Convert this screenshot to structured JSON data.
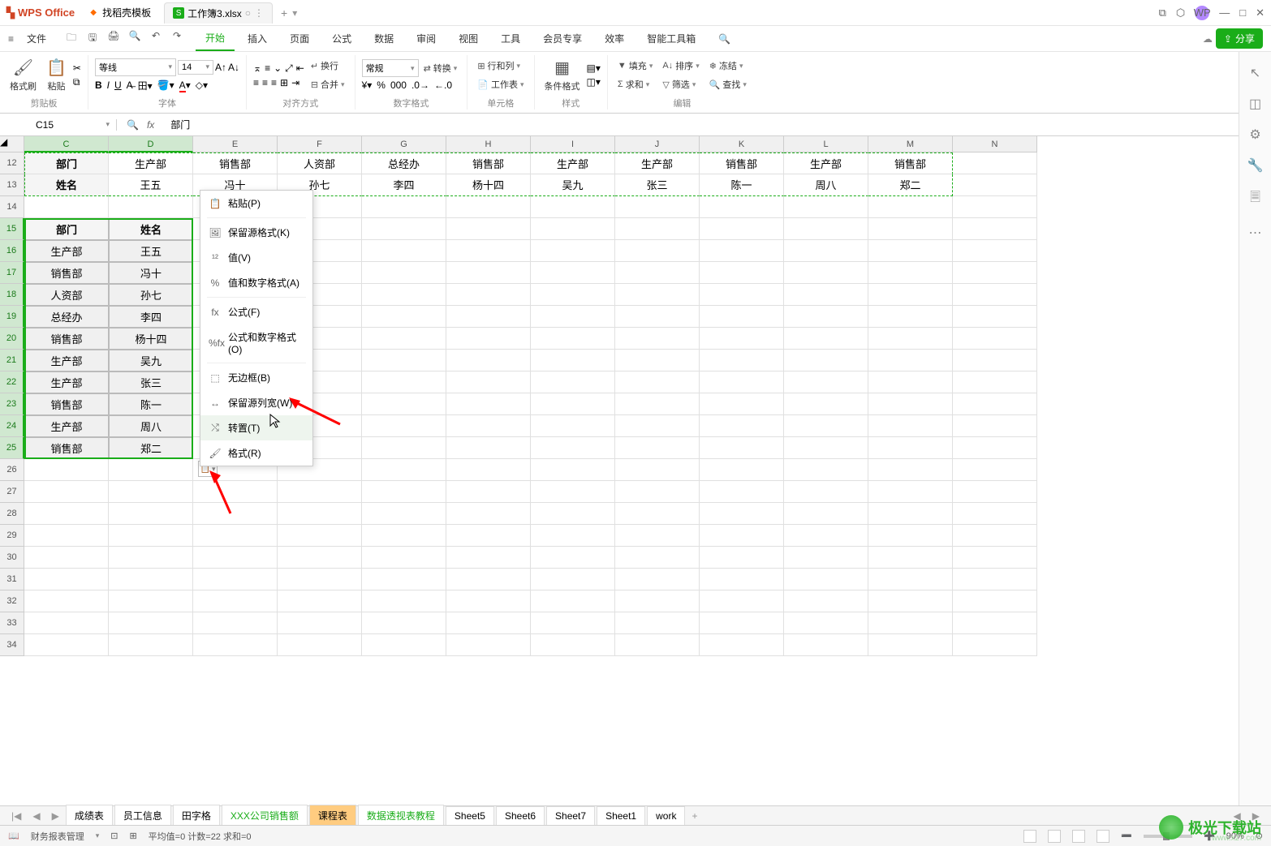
{
  "titlebar": {
    "app_name": "WPS Office",
    "template_tab": "找稻壳模板",
    "workbook_tab": "工作簿3.xlsx",
    "plus": "+"
  },
  "menubar": {
    "file": "文件",
    "tabs": [
      "开始",
      "插入",
      "页面",
      "公式",
      "数据",
      "审阅",
      "视图",
      "工具",
      "会员专享",
      "效率",
      "智能工具箱"
    ],
    "share": "分享"
  },
  "ribbon": {
    "group_clip": "剪贴板",
    "format_painter": "格式刷",
    "paste": "粘贴",
    "group_font": "字体",
    "font_name": "等线",
    "font_size": "14",
    "group_align": "对齐方式",
    "wrap": "换行",
    "merge": "合并",
    "group_number": "数字格式",
    "number_format": "常规",
    "convert": "转换",
    "group_cell": "单元格",
    "rows_cols": "行和列",
    "worksheet": "工作表",
    "group_style": "样式",
    "cond_format": "条件格式",
    "group_edit": "编辑",
    "fill": "填充",
    "sort": "排序",
    "sum": "求和",
    "filter": "筛选",
    "freeze": "冻结",
    "find": "查找"
  },
  "formula": {
    "cell_ref": "C15",
    "value": "部门"
  },
  "col_letters": [
    "C",
    "D",
    "E",
    "F",
    "G",
    "H",
    "I",
    "J",
    "K",
    "L",
    "M",
    "N"
  ],
  "row_numbers": [
    "12",
    "13",
    "14",
    "15",
    "16",
    "17",
    "18",
    "19",
    "20",
    "21",
    "22",
    "23",
    "24",
    "25",
    "26",
    "27",
    "28",
    "29",
    "30",
    "31",
    "32",
    "33",
    "34"
  ],
  "marquee_row1": [
    "部门",
    "生产部",
    "销售部",
    "人资部",
    "总经办",
    "销售部",
    "生产部",
    "生产部",
    "销售部",
    "生产部",
    "销售部"
  ],
  "marquee_row2": [
    "姓名",
    "王五",
    "冯十",
    "孙七",
    "李四",
    "杨十四",
    "吴九",
    "张三",
    "陈一",
    "周八",
    "郑二"
  ],
  "paste_headers": [
    "部门",
    "姓名"
  ],
  "paste_data": [
    [
      "生产部",
      "王五"
    ],
    [
      "销售部",
      "冯十"
    ],
    [
      "人资部",
      "孙七"
    ],
    [
      "总经办",
      "李四"
    ],
    [
      "销售部",
      "杨十四"
    ],
    [
      "生产部",
      "吴九"
    ],
    [
      "生产部",
      "张三"
    ],
    [
      "销售部",
      "陈一"
    ],
    [
      "生产部",
      "周八"
    ],
    [
      "销售部",
      "郑二"
    ]
  ],
  "context_menu": {
    "paste": "粘贴(P)",
    "keep_source_format": "保留源格式(K)",
    "values": "值(V)",
    "values_num_format": "值和数字格式(A)",
    "formulas": "公式(F)",
    "formulas_num_format": "公式和数字格式(O)",
    "no_border": "无边框(B)",
    "keep_col_width": "保留源列宽(W)",
    "transpose": "转置(T)",
    "format": "格式(R)"
  },
  "sheet_tabs": [
    "成绩表",
    "员工信息",
    "田字格",
    "XXX公司销售额",
    "课程表",
    "数据透视表教程",
    "Sheet5",
    "Sheet6",
    "Sheet7",
    "Sheet1",
    "work"
  ],
  "status": {
    "book": "财务报表管理",
    "stats": "平均值=0  计数=22  求和=0",
    "zoom": "90%"
  },
  "watermark": {
    "text": "极光下载站",
    "url": "www.xz7.com"
  }
}
